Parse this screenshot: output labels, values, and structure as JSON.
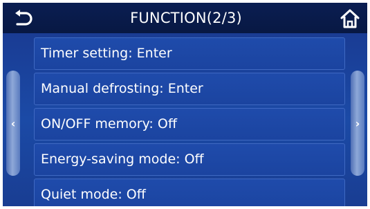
{
  "header": {
    "title": "FUNCTION(2/3)",
    "back_icon": "back-arrow-icon",
    "home_icon": "home-icon"
  },
  "nav": {
    "prev_glyph": "‹",
    "next_glyph": "›"
  },
  "menu": {
    "items": [
      {
        "label": "Timer setting: Enter"
      },
      {
        "label": "Manual defrosting: Enter"
      },
      {
        "label": "ON/OFF memory: Off"
      },
      {
        "label": "Energy-saving mode: Off"
      },
      {
        "label": "Quiet mode: Off"
      }
    ]
  },
  "colors": {
    "header_bg": "#0a1e52",
    "panel_bg": "#1b4aa6",
    "text": "#ffffff"
  }
}
